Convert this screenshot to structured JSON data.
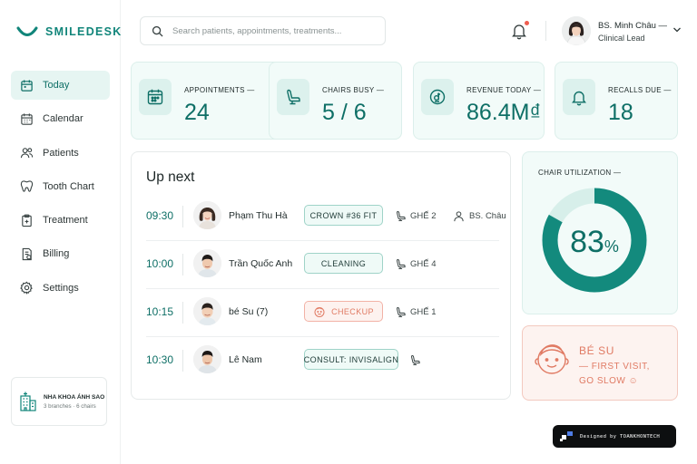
{
  "brand": {
    "name": "SMILEDESK",
    "accent": "#11857a"
  },
  "sidebar": {
    "items": [
      {
        "label": "Today",
        "icon": "calendar-today-icon",
        "active": true
      },
      {
        "label": "Calendar",
        "icon": "calendar-icon"
      },
      {
        "label": "Patients",
        "icon": "users-icon"
      },
      {
        "label": "Tooth Chart",
        "icon": "tooth-icon"
      },
      {
        "label": "Treatment",
        "icon": "clipboard-icon"
      },
      {
        "label": "Billing",
        "icon": "billing-icon"
      },
      {
        "label": "Settings",
        "icon": "gear-icon"
      }
    ],
    "branch": {
      "name": "NHA KHOA ÁNH SAO",
      "sub": "3 branches · 6 chairs"
    }
  },
  "header": {
    "search_placeholder": "Search patients, appointments, treatments...",
    "user": {
      "name": "BS. Minh Châu —",
      "role": "Clinical Lead"
    }
  },
  "stats": [
    {
      "label": "APPOINTMENTS —",
      "value": "24",
      "icon": "calendar-grid-icon"
    },
    {
      "label": "CHAIRS BUSY —",
      "value": "5 / 6",
      "icon": "dental-chair-icon"
    },
    {
      "label": "REVENUE TODAY —",
      "value": "86.4M₫",
      "icon": "dong-coin-icon"
    },
    {
      "label": "RECALLS DUE —",
      "value": "18",
      "icon": "bell-icon"
    }
  ],
  "upnext": {
    "title": "Up next",
    "appointments": [
      {
        "time": "09:30",
        "patient": "Phạm Thu Hà",
        "tag": "CROWN #36 FIT",
        "chair": "GHẾ 2",
        "doctor": "BS. Châu"
      },
      {
        "time": "10:00",
        "patient": "Trần Quốc Anh",
        "tag": "CLEANING",
        "chair": "GHẾ 4"
      },
      {
        "time": "10:15",
        "patient": "bé Su (7)",
        "tag": "CHECKUP",
        "chair": "GHẾ 1"
      },
      {
        "time": "10:30",
        "patient": "Lê Nam",
        "tag": "CONSULT: INVISALIGN",
        "chair": ""
      }
    ]
  },
  "utilization": {
    "label": "CHAIR UTILIZATION —",
    "value": "83",
    "unit": "%",
    "percent": 83
  },
  "note": {
    "name": "BÉ SU",
    "line1": "— FIRST VISIT,",
    "line2": "GO SLOW ☺"
  },
  "credit": {
    "text": "Designed by TOANKHONTECH"
  }
}
